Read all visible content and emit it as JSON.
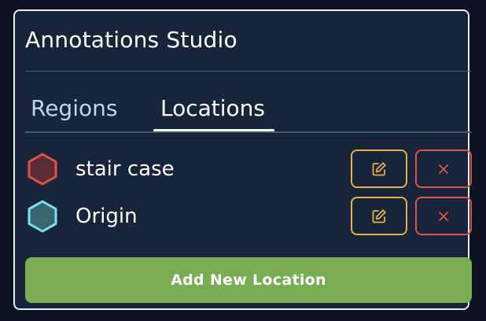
{
  "panel": {
    "title": "Annotations Studio"
  },
  "tabs": [
    {
      "label": "Regions",
      "active": false
    },
    {
      "label": "Locations",
      "active": true
    }
  ],
  "locations": [
    {
      "label": "stair case",
      "color": "#e05243",
      "fill": "#5a2c38"
    },
    {
      "label": "Origin",
      "color": "#74e6f2",
      "fill": "#3a6670"
    }
  ],
  "actions": {
    "edit_color": "#e0b049",
    "delete_color": "#d9544a",
    "add_label": "Add New Location",
    "add_color": "#78ad53"
  }
}
